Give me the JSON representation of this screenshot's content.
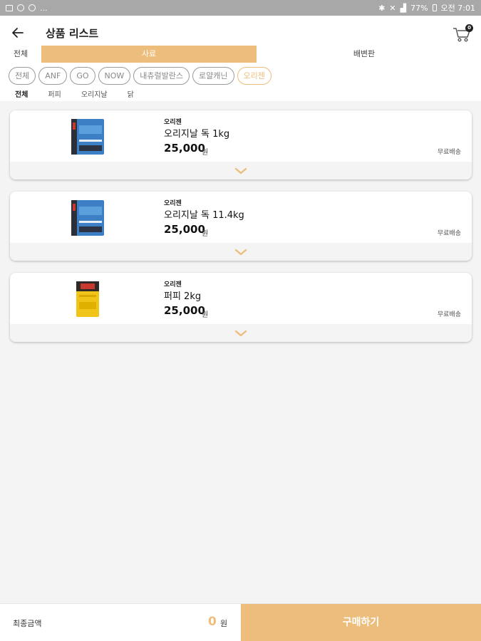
{
  "status_bar": {
    "left_text": "...",
    "battery": "77%",
    "time": "오전 7:01"
  },
  "header": {
    "title": "상품 리스트",
    "back_icon": "arrow-left-icon",
    "cart_icon": "cart-icon",
    "cart_count": "0"
  },
  "tabs": [
    {
      "label": "전체",
      "active": false
    },
    {
      "label": "사료",
      "active": true
    },
    {
      "label": "배변판",
      "active": false
    }
  ],
  "brand_chips": [
    {
      "label": "전체",
      "active": false
    },
    {
      "label": "ANF",
      "active": false
    },
    {
      "label": "GO",
      "active": false
    },
    {
      "label": "NOW",
      "active": false
    },
    {
      "label": "내츄럴발란스",
      "active": false
    },
    {
      "label": "로얄캐닌",
      "active": false
    },
    {
      "label": "오리젠",
      "active": true
    }
  ],
  "subtabs": [
    {
      "label": "전체",
      "active": true
    },
    {
      "label": "퍼피",
      "active": false
    },
    {
      "label": "오리지날",
      "active": false
    },
    {
      "label": "닭",
      "active": false
    }
  ],
  "products": [
    {
      "brand": "오리젠",
      "name": "오리지날 독 1kg",
      "price": "25,000",
      "unit": "원",
      "shipping": "무료배송",
      "package_color": "blue"
    },
    {
      "brand": "오리젠",
      "name": "오리지날 독 11.4kg",
      "price": "25,000",
      "unit": "원",
      "shipping": "무료배송",
      "package_color": "blue"
    },
    {
      "brand": "오리젠",
      "name": "퍼피 2kg",
      "price": "25,000",
      "unit": "원",
      "shipping": "무료배송",
      "package_color": "yellow"
    }
  ],
  "footer": {
    "total_label": "최종금액",
    "total_value": "0",
    "total_unit": "원",
    "buy_label": "구매하기"
  },
  "colors": {
    "accent": "#edbd7b",
    "status_bar": "#a8a8a8",
    "background": "#f4f4f4"
  }
}
